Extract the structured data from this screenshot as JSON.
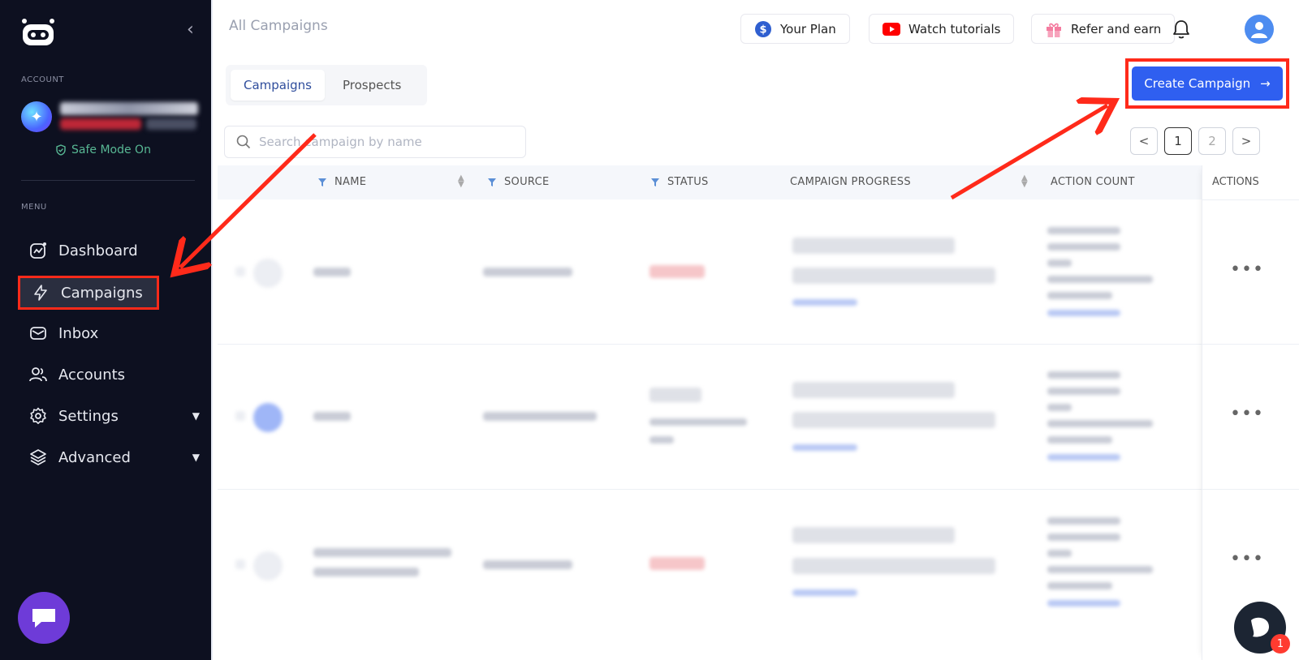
{
  "sidebar": {
    "account_label": "ACCOUNT",
    "safe_mode": "Safe Mode On",
    "menu_label": "MENU",
    "items": [
      {
        "label": "Dashboard"
      },
      {
        "label": "Campaigns"
      },
      {
        "label": "Inbox"
      },
      {
        "label": "Accounts"
      },
      {
        "label": "Settings"
      },
      {
        "label": "Advanced"
      }
    ]
  },
  "header": {
    "title": "All Campaigns",
    "your_plan": "Your Plan",
    "watch_tutorials": "Watch tutorials",
    "refer_and_earn": "Refer and earn"
  },
  "tabs": {
    "campaigns": "Campaigns",
    "prospects": "Prospects"
  },
  "create_campaign": "Create Campaign",
  "search": {
    "placeholder": "Search campaign by name"
  },
  "pagination": {
    "prev": "<",
    "page1": "1",
    "page2": "2",
    "next": ">"
  },
  "table": {
    "columns": {
      "name": "NAME",
      "source": "SOURCE",
      "status": "STATUS",
      "progress": "CAMPAIGN PROGRESS",
      "action_count": "ACTION COUNT",
      "actions": "ACTIONS"
    },
    "row_action": "•••"
  },
  "help_badge": "1",
  "colors": {
    "sidebar_bg": "#0d1020",
    "primary": "#2f5ff0",
    "highlight": "#ff2a1a"
  }
}
